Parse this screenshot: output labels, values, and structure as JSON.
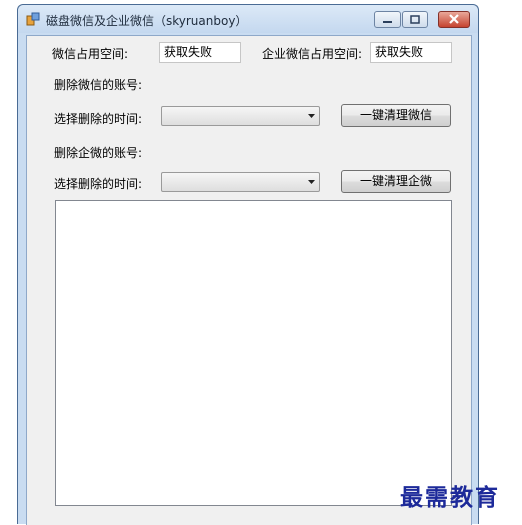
{
  "window": {
    "title": "磁盘微信及企业微信（skyruanboy）"
  },
  "fields": {
    "wechat_space_label": "微信占用空间:",
    "wechat_space_value": "获取失败",
    "work_wechat_space_label": "企业微信占用空间:",
    "work_wechat_space_value": "获取失败"
  },
  "wechat_section": {
    "account_label": "删除微信的账号:",
    "time_label": "选择删除的时间:",
    "time_selected": "",
    "clean_button": "一键清理微信"
  },
  "work_wechat_section": {
    "account_label": "删除企微的账号:",
    "time_label": "选择删除的时间:",
    "time_selected": "",
    "clean_button": "一键清理企微"
  },
  "output_log": "",
  "watermark": "最需教育",
  "colors": {
    "title_bar": "#c9dcf1",
    "client_bg": "#f0f0f0",
    "close_button": "#c5432f",
    "watermark": "#1d2a9a"
  }
}
